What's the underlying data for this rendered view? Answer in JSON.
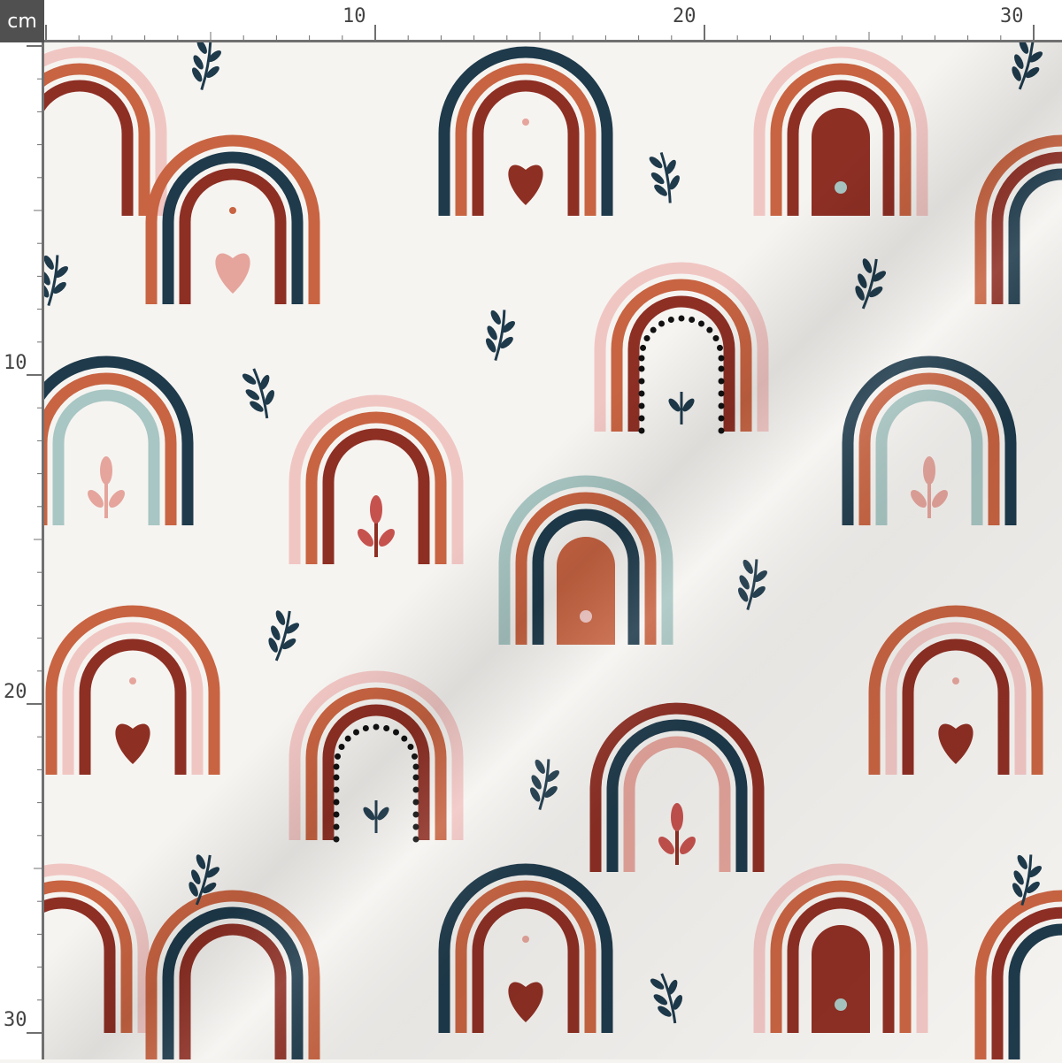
{
  "ruler": {
    "unit": "cm",
    "top_labels": [
      "10",
      "20",
      "30"
    ],
    "left_labels": [
      "10",
      "20",
      "30"
    ]
  },
  "colors": {
    "background": "#f6f4f1",
    "navy": "#1e3a4b",
    "rust": "#c86442",
    "brick": "#8e2f24",
    "pink": "#f0c6c3",
    "blush": "#e5a59c",
    "sage": "#a8c6c3",
    "leaf": "#1e3a4b"
  },
  "pattern": {
    "motif": "boho rainbows with hearts, dots and leaves",
    "repeat_icons": [
      "rainbow-icon",
      "heart-icon",
      "leaf-sprig-icon",
      "dot-arch-icon"
    ]
  }
}
